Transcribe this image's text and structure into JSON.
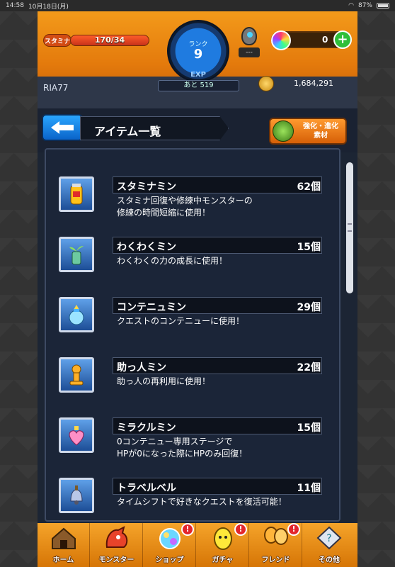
{
  "status_bar": {
    "time": "14:58",
    "date": "10月18日(月)",
    "battery": "87%"
  },
  "header": {
    "stamina_label": "スタミナ",
    "stamina_value": "170/34",
    "stamina_fill_fraction": 1.0,
    "rank_label": "ランク",
    "rank_value": "9",
    "exp_label": "EXP",
    "exp_remaining": "あと 519",
    "egg_count": "---",
    "orb_count": "0",
    "player_name": "RIA77",
    "gold": "1,684,291"
  },
  "title_row": {
    "title": "アイテム一覧",
    "evolve_label_line1": "強化・進化",
    "evolve_label_line2": "素材"
  },
  "items": [
    {
      "name": "スタミナミン",
      "count": "62個",
      "desc_line1": "スタミナ回復や修練中モンスターの",
      "desc_line2": "修練の時間短縮に使用！",
      "icon": "stamina-can-icon"
    },
    {
      "name": "わくわくミン",
      "count": "15個",
      "desc_line1": "わくわくの力の成長に使用！",
      "desc_line2": "",
      "icon": "sprout-bottle-icon"
    },
    {
      "name": "コンテニュミン",
      "count": "29個",
      "desc_line1": "クエストのコンテニューに使用！",
      "desc_line2": "",
      "icon": "crystal-jar-icon"
    },
    {
      "name": "助っ人ミン",
      "count": "22個",
      "desc_line1": "助っ人の再利用に使用！",
      "desc_line2": "",
      "icon": "pawn-icon"
    },
    {
      "name": "ミラクルミン",
      "count": "15個",
      "desc_line1": "0コンテニュー専用ステージで",
      "desc_line2": "HPが0になった際にHPのみ回復！",
      "icon": "heart-bottle-icon"
    },
    {
      "name": "トラベルベル",
      "count": "11個",
      "desc_line1": "タイムシフトで好きなクエストを復活可能！",
      "desc_line2": "",
      "icon": "bell-icon"
    }
  ],
  "nav": [
    {
      "label": "ホーム",
      "icon": "home-icon",
      "badge": ""
    },
    {
      "label": "モンスター",
      "icon": "monster-icon",
      "badge": ""
    },
    {
      "label": "ショップ",
      "icon": "orb-shop-icon",
      "badge": "!"
    },
    {
      "label": "ガチャ",
      "icon": "gacha-egg-icon",
      "badge": "!"
    },
    {
      "label": "フレンド",
      "icon": "friend-balloon-icon",
      "badge": "!"
    },
    {
      "label": "その他",
      "icon": "other-icon",
      "badge": ""
    }
  ]
}
